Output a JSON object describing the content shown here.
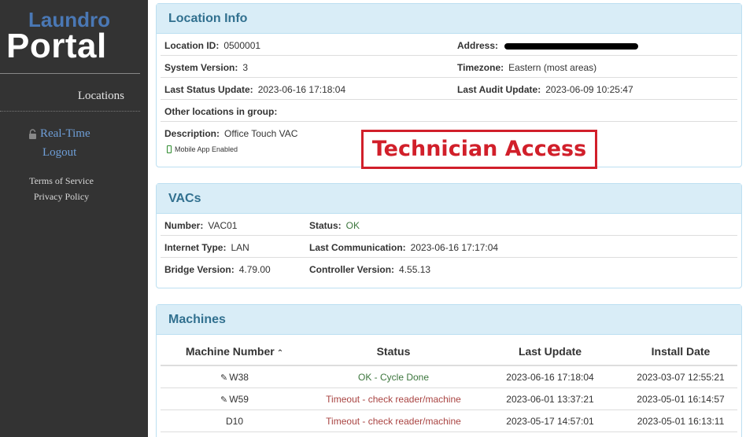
{
  "sidebar": {
    "brand_top": "Laundro",
    "brand_bottom": "Portal",
    "locations": "Locations",
    "realtime": "Real-Time",
    "logout": "Logout",
    "terms": "Terms of Service",
    "privacy": "Privacy Policy"
  },
  "location_info": {
    "title": "Location Info",
    "location_id_label": "Location ID:",
    "location_id": "0500001",
    "address_label": "Address:",
    "system_version_label": "System Version:",
    "system_version": "3",
    "timezone_label": "Timezone:",
    "timezone": "Eastern (most areas)",
    "last_status_label": "Last Status Update:",
    "last_status": "2023-06-16 17:18:04",
    "last_audit_label": "Last Audit Update:",
    "last_audit": "2023-06-09 10:25:47",
    "other_locations_label": "Other locations in group:",
    "description_label": "Description:",
    "description": "Office Touch VAC",
    "mobile_app": "Mobile App Enabled"
  },
  "overlay": {
    "technician_access": "Technician Access",
    "color": "#d11f2a"
  },
  "vacs": {
    "title": "VACs",
    "number_label": "Number:",
    "number": "VAC01",
    "status_label": "Status:",
    "status": "OK",
    "internet_label": "Internet Type:",
    "internet": "LAN",
    "last_comm_label": "Last Communication:",
    "last_comm": "2023-06-16 17:17:04",
    "bridge_label": "Bridge Version:",
    "bridge": "4.79.00",
    "controller_label": "Controller Version:",
    "controller": "4.55.13"
  },
  "machines": {
    "title": "Machines",
    "headers": {
      "machine_number": "Machine Number",
      "status": "Status",
      "last_update": "Last Update",
      "install_date": "Install Date"
    },
    "rows": [
      {
        "number": "W38",
        "status": "OK - Cycle Done",
        "last_update": "2023-06-16 17:18:04",
        "install_date": "2023-03-07 12:55:21"
      },
      {
        "number": "W59",
        "status": "Timeout - check reader/machine",
        "last_update": "2023-06-01 13:37:21",
        "install_date": "2023-05-01 16:14:57"
      },
      {
        "number": "D10",
        "status": "Timeout - check reader/machine",
        "last_update": "2023-05-17 14:57:01",
        "install_date": "2023-05-01 16:13:11"
      }
    ]
  },
  "colors": {
    "sidebar_bg": "#333333",
    "panel_head_bg": "#d9edf7",
    "panel_title": "#31708f",
    "ok": "#3c763d",
    "error": "#a94442"
  }
}
